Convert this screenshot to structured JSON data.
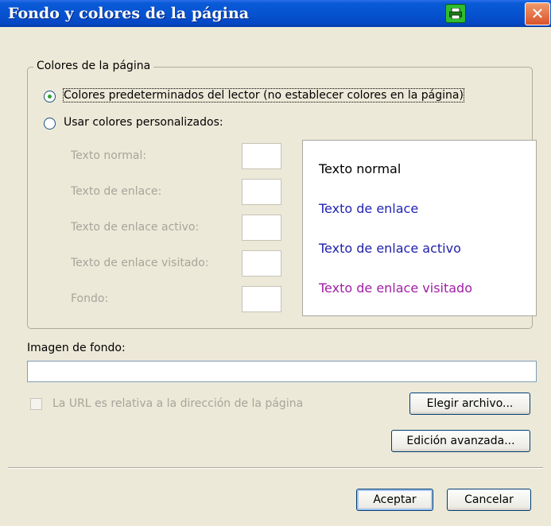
{
  "window": {
    "title": "Fondo y colores de la página",
    "close_glyph": "✕",
    "title_icon": "printer-icon"
  },
  "colors_group": {
    "label": "Colores de la página",
    "option_default": "Colores predeterminados del lector (no establecer colores en la página)",
    "option_default_selected": true,
    "option_custom": "Usar colores personalizados:",
    "fields": [
      {
        "label": "Texto normal:",
        "accesskey": "n"
      },
      {
        "label": "Texto de enlace:",
        "accesskey": "l"
      },
      {
        "label": "Texto de enlace activo:",
        "accesskey": "a"
      },
      {
        "label": "Texto de enlace visitado:",
        "accesskey": "v"
      },
      {
        "label": "Fondo:",
        "accesskey": "F"
      }
    ],
    "preview": [
      {
        "text": "Texto normal",
        "color": "#000000"
      },
      {
        "text": "Texto de enlace",
        "color": "#2323b4"
      },
      {
        "text": "Texto de enlace activo",
        "color": "#1e1eaa"
      },
      {
        "text": "Texto de enlace visitado",
        "color": "#a01ea5"
      }
    ]
  },
  "background_image": {
    "label": "Imagen de fondo:",
    "value": "",
    "relative_checkbox_label": "La URL es relativa a la dirección de la página",
    "relative_checked": false
  },
  "buttons": {
    "choose_file": "Elegir archivo...",
    "advanced_edit": "Edición avanzada...",
    "accept": "Aceptar",
    "cancel": "Cancelar"
  }
}
